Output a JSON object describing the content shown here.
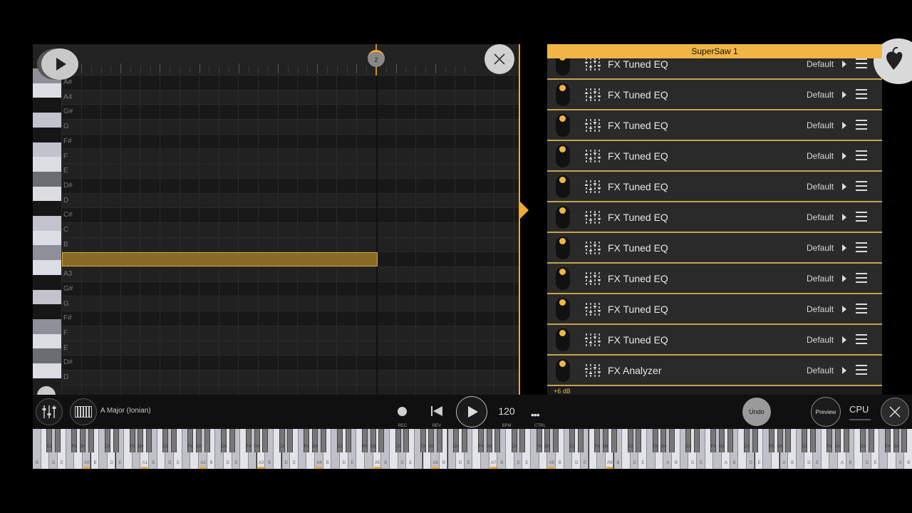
{
  "piano_roll": {
    "bar_marker": "2",
    "key_labels": [
      "A#",
      "A4",
      "G#",
      "G",
      "F#",
      "F",
      "E",
      "D#",
      "D",
      "C#",
      "C",
      "B",
      "A#",
      "A3",
      "G#",
      "G",
      "F#",
      "F",
      "E",
      "D#",
      "D"
    ],
    "note": {
      "pitch": "A#3",
      "start_beat": 0,
      "length_beats": 4
    }
  },
  "fx_panel": {
    "title": "SuperSaw 1",
    "items": [
      {
        "name": "FX Tuned EQ",
        "preset": "Default"
      },
      {
        "name": "FX Tuned EQ",
        "preset": "Default"
      },
      {
        "name": "FX Tuned EQ",
        "preset": "Default"
      },
      {
        "name": "FX Tuned EQ",
        "preset": "Default"
      },
      {
        "name": "FX Tuned EQ",
        "preset": "Default"
      },
      {
        "name": "FX Tuned EQ",
        "preset": "Default"
      },
      {
        "name": "FX Tuned EQ",
        "preset": "Default"
      },
      {
        "name": "FX Tuned EQ",
        "preset": "Default"
      },
      {
        "name": "FX Tuned EQ",
        "preset": "Default"
      },
      {
        "name": "FX Tuned EQ",
        "preset": "Default"
      },
      {
        "name": "FX Analyzer",
        "preset": "Default"
      }
    ],
    "gain": "+6 dB"
  },
  "toolbar": {
    "scale": "A Major (Ionian)",
    "rec_label": "REC",
    "rev_label": "REV",
    "bpm_value": "120",
    "bpm_label": "BPM",
    "ctrl_label": "CTRL",
    "ctrl_dots": "•••",
    "undo": "Undo",
    "preview": "Preview",
    "cpu": "CPU"
  },
  "keyboard": {
    "octave_labels": [
      "A0",
      "A1",
      "A2",
      "A3",
      "A4",
      "A5",
      "A6",
      "A7",
      "A8",
      "A9"
    ],
    "white_labels": [
      "D",
      "E",
      "A",
      "B"
    ],
    "black_labels": [
      "C#",
      "F#",
      "G#"
    ]
  },
  "colors": {
    "accent": "#f0b545",
    "note_fill": "#8a6b25",
    "note_border": "#d8a838"
  },
  "icons": [
    "play-icon",
    "close-icon",
    "eq-icon",
    "menu-icon",
    "mixer-icon",
    "keyboard-icon",
    "rewind-icon",
    "fl-fruit-logo"
  ]
}
